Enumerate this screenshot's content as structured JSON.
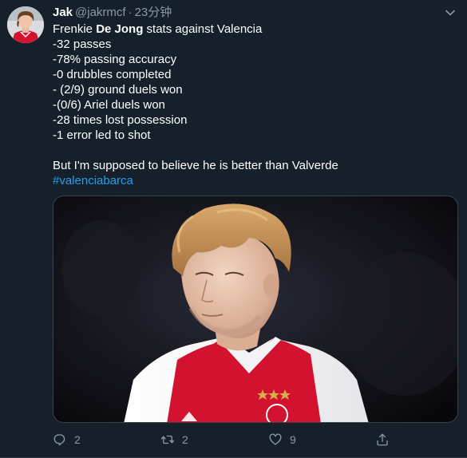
{
  "tweet": {
    "display_name": "Jak",
    "handle": "@jakrmcf",
    "separator": "·",
    "time": "23分钟",
    "body": {
      "line1_pre": "Frenkie ",
      "line1_bold": "De Jong",
      "line1_post": " stats against Valencia",
      "stats": [
        "-32 passes",
        "-78% passing accuracy",
        "-0 drubbles completed",
        "- (2/9) ground duels won",
        "-(0/6) Ariel duels won",
        "-28 times lost possession",
        "-1 error led to shot"
      ],
      "closing": "But I'm supposed to believe he is better than Valverde",
      "hashtag": "#valenciabarca"
    },
    "actions": {
      "reply_count": "2",
      "retweet_count": "2",
      "like_count": "9"
    },
    "colors": {
      "background": "#15202b",
      "muted": "#8899a6",
      "link": "#1da1f2",
      "jersey_red": "#d2122e"
    },
    "icons": {
      "reply": "reply-icon",
      "retweet": "retweet-icon",
      "like": "heart-icon",
      "share": "share-icon",
      "menu": "chevron-down-icon"
    }
  }
}
